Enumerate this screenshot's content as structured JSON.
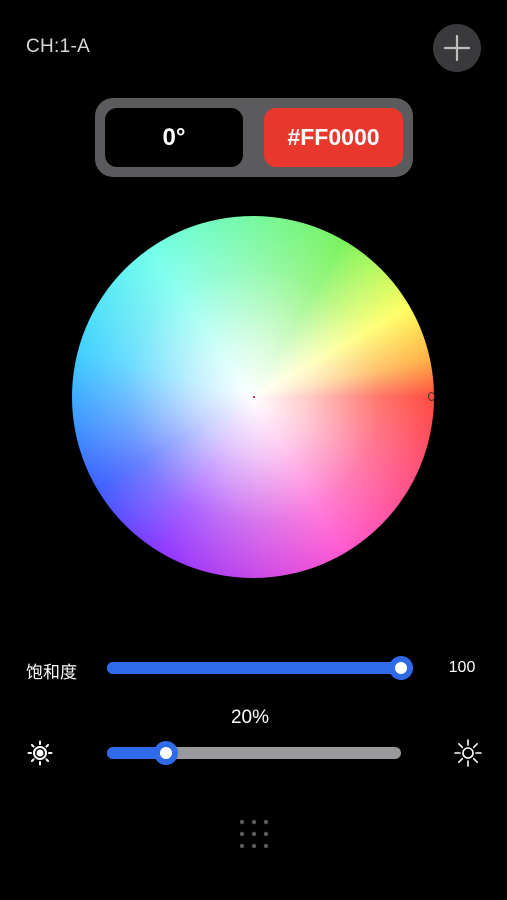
{
  "header": {
    "channel_label": "CH:1-A",
    "add_icon": "plus-icon"
  },
  "color_readout": {
    "hue_label": "0°",
    "hex_label": "#FF0000",
    "hex_color": "#e8382e"
  },
  "color_wheel": {
    "selected_hue_deg": 0,
    "selected_saturation": 1.0
  },
  "saturation": {
    "label": "饱和度",
    "value_label": "100",
    "level": 1.0
  },
  "brightness": {
    "value_label": "20%",
    "level": 0.2,
    "min_icon": "sun-dim-icon",
    "max_icon": "sun-bright-icon"
  },
  "footer": {
    "handle_icon": "grid-handle-icon"
  },
  "colors": {
    "accent": "#2f6be8",
    "track": "#9a9a9c",
    "panel": "#5b5b5e",
    "button": "#3a3a3c"
  }
}
